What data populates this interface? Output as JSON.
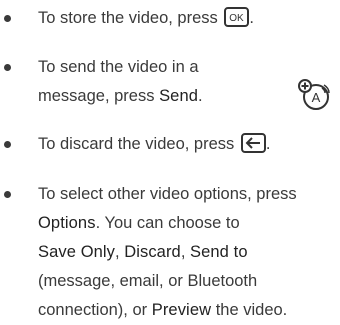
{
  "items": [
    {
      "lines": [
        {
          "a": "To store the video, press ",
          "key": "ok-key-icon",
          "b": "."
        }
      ]
    },
    {
      "lines": [
        {
          "a": "To send the video in a"
        },
        {
          "a": "message, press ",
          "kw": "Send",
          "b": "."
        }
      ],
      "side_icon": "message-attachment-icon"
    },
    {
      "lines": [
        {
          "a": "To discard the video, press ",
          "key": "back-key-icon",
          "b": "."
        }
      ]
    },
    {
      "lines": [
        {
          "a": "To select other video options, press"
        },
        {
          "kw": "Options",
          "b": ". You can choose to"
        },
        {
          "kw": "Save Only",
          "b1": ", ",
          "kw2": "Discard",
          "b2": ", ",
          "kw3": "Send to"
        },
        {
          "a": "(message, email, or Bluetooth"
        },
        {
          "a": "connection), or ",
          "kw": "Preview",
          "b": " the video."
        }
      ]
    }
  ]
}
